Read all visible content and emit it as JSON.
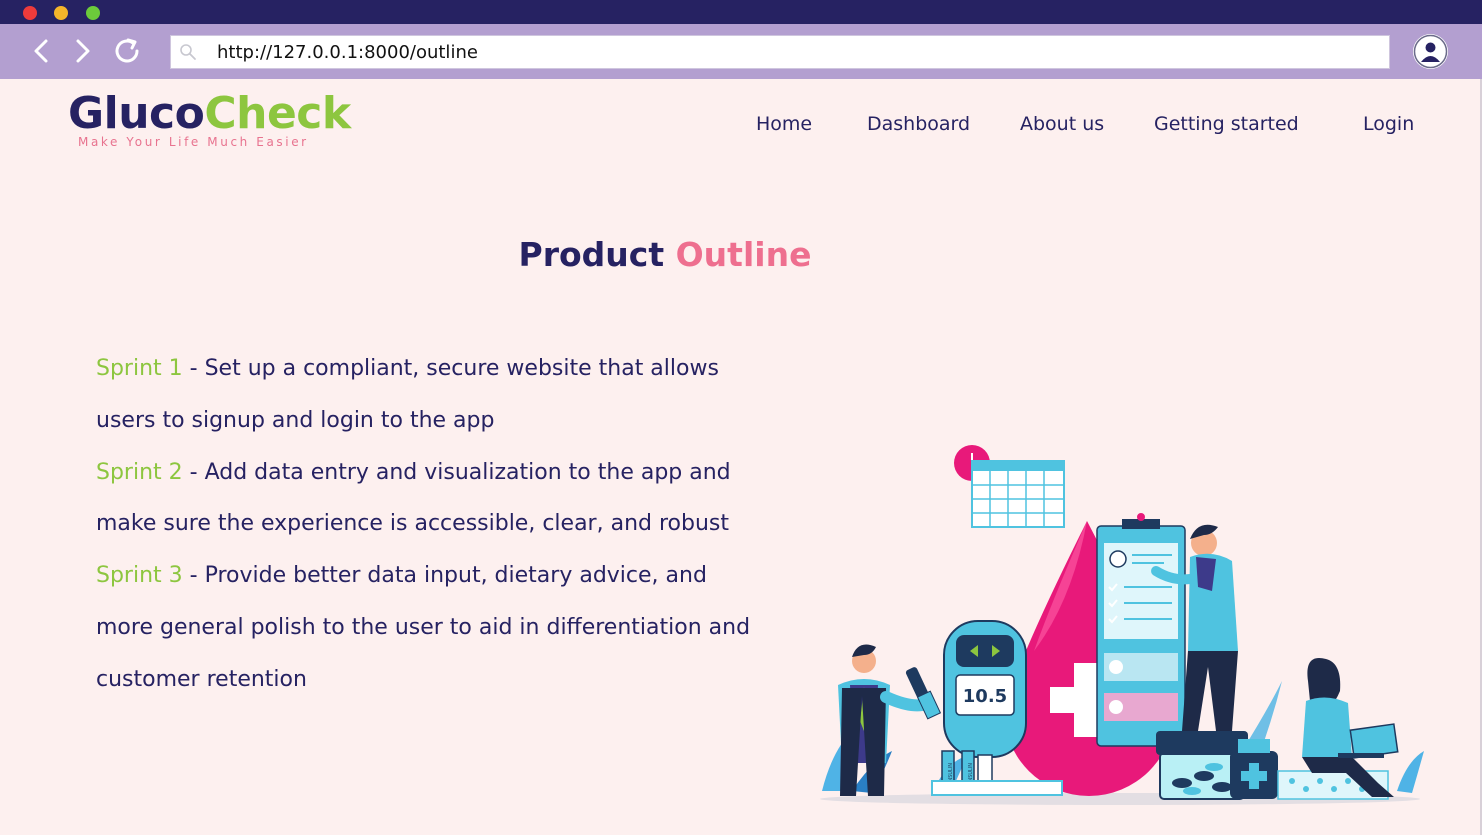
{
  "window": {
    "controls": [
      "close",
      "minimize",
      "maximize"
    ],
    "colors": {
      "titlebar": "#262262",
      "toolbar": "#b39fd0",
      "page_bg": "#fdf0ef"
    }
  },
  "browser": {
    "back_icon": "chevron-left-icon",
    "forward_icon": "chevron-right-icon",
    "reload_icon": "reload-icon",
    "url": "http://127.0.0.1:8000/outline",
    "search_icon": "search-icon",
    "profile_icon": "user-avatar-icon"
  },
  "logo": {
    "part1": "Gluco",
    "part2": "Check",
    "tagline": "Make Your Life Much Easier",
    "colors": {
      "primary": "#262262",
      "accent": "#8dc63f",
      "tagline": "#e8738f"
    }
  },
  "nav": {
    "home": "Home",
    "dashboard": "Dashboard",
    "about": "About us",
    "getting_started": "Getting started",
    "login": "Login"
  },
  "heading": {
    "part1": "Product",
    "part2": "Outline"
  },
  "sprints": [
    {
      "label": "Sprint 1",
      "text": " - Set up a compliant, secure website that allows users to signup and login to the app"
    },
    {
      "label": "Sprint 2",
      "text": " - Add data entry and visualization to the app and make sure the experience is accessible, clear, and robust"
    },
    {
      "label": "Sprint 3",
      "text": " - Provide better data input, dietary advice, and more general polish to the user to aid in differentiation and customer retention"
    }
  ],
  "illustration": {
    "glucometer_reading": "10.5",
    "insulin_label": "INSULIN"
  }
}
